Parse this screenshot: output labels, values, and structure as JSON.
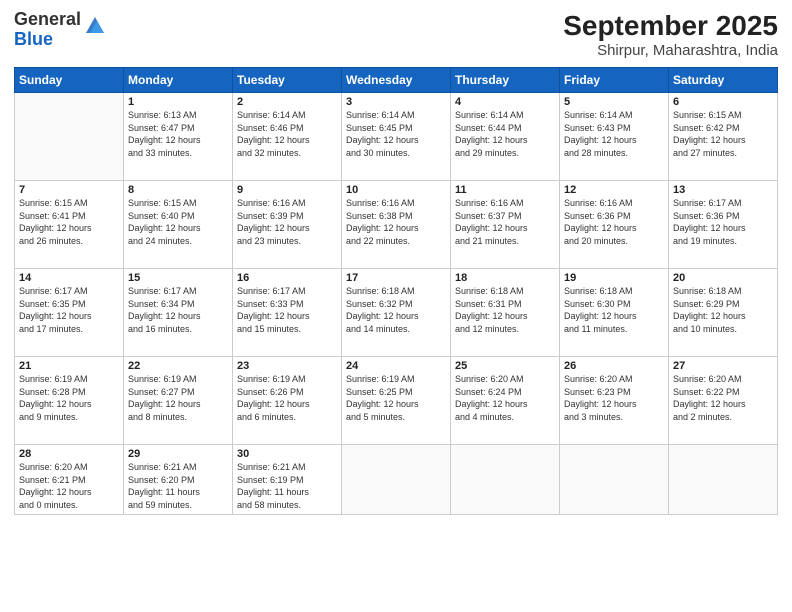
{
  "header": {
    "logo": {
      "line1": "General",
      "line2": "Blue"
    },
    "title": "September 2025",
    "location": "Shirpur, Maharashtra, India"
  },
  "weekdays": [
    "Sunday",
    "Monday",
    "Tuesday",
    "Wednesday",
    "Thursday",
    "Friday",
    "Saturday"
  ],
  "weeks": [
    [
      {
        "day": "",
        "info": ""
      },
      {
        "day": "1",
        "info": "Sunrise: 6:13 AM\nSunset: 6:47 PM\nDaylight: 12 hours\nand 33 minutes."
      },
      {
        "day": "2",
        "info": "Sunrise: 6:14 AM\nSunset: 6:46 PM\nDaylight: 12 hours\nand 32 minutes."
      },
      {
        "day": "3",
        "info": "Sunrise: 6:14 AM\nSunset: 6:45 PM\nDaylight: 12 hours\nand 30 minutes."
      },
      {
        "day": "4",
        "info": "Sunrise: 6:14 AM\nSunset: 6:44 PM\nDaylight: 12 hours\nand 29 minutes."
      },
      {
        "day": "5",
        "info": "Sunrise: 6:14 AM\nSunset: 6:43 PM\nDaylight: 12 hours\nand 28 minutes."
      },
      {
        "day": "6",
        "info": "Sunrise: 6:15 AM\nSunset: 6:42 PM\nDaylight: 12 hours\nand 27 minutes."
      }
    ],
    [
      {
        "day": "7",
        "info": "Sunrise: 6:15 AM\nSunset: 6:41 PM\nDaylight: 12 hours\nand 26 minutes."
      },
      {
        "day": "8",
        "info": "Sunrise: 6:15 AM\nSunset: 6:40 PM\nDaylight: 12 hours\nand 24 minutes."
      },
      {
        "day": "9",
        "info": "Sunrise: 6:16 AM\nSunset: 6:39 PM\nDaylight: 12 hours\nand 23 minutes."
      },
      {
        "day": "10",
        "info": "Sunrise: 6:16 AM\nSunset: 6:38 PM\nDaylight: 12 hours\nand 22 minutes."
      },
      {
        "day": "11",
        "info": "Sunrise: 6:16 AM\nSunset: 6:37 PM\nDaylight: 12 hours\nand 21 minutes."
      },
      {
        "day": "12",
        "info": "Sunrise: 6:16 AM\nSunset: 6:36 PM\nDaylight: 12 hours\nand 20 minutes."
      },
      {
        "day": "13",
        "info": "Sunrise: 6:17 AM\nSunset: 6:36 PM\nDaylight: 12 hours\nand 19 minutes."
      }
    ],
    [
      {
        "day": "14",
        "info": "Sunrise: 6:17 AM\nSunset: 6:35 PM\nDaylight: 12 hours\nand 17 minutes."
      },
      {
        "day": "15",
        "info": "Sunrise: 6:17 AM\nSunset: 6:34 PM\nDaylight: 12 hours\nand 16 minutes."
      },
      {
        "day": "16",
        "info": "Sunrise: 6:17 AM\nSunset: 6:33 PM\nDaylight: 12 hours\nand 15 minutes."
      },
      {
        "day": "17",
        "info": "Sunrise: 6:18 AM\nSunset: 6:32 PM\nDaylight: 12 hours\nand 14 minutes."
      },
      {
        "day": "18",
        "info": "Sunrise: 6:18 AM\nSunset: 6:31 PM\nDaylight: 12 hours\nand 12 minutes."
      },
      {
        "day": "19",
        "info": "Sunrise: 6:18 AM\nSunset: 6:30 PM\nDaylight: 12 hours\nand 11 minutes."
      },
      {
        "day": "20",
        "info": "Sunrise: 6:18 AM\nSunset: 6:29 PM\nDaylight: 12 hours\nand 10 minutes."
      }
    ],
    [
      {
        "day": "21",
        "info": "Sunrise: 6:19 AM\nSunset: 6:28 PM\nDaylight: 12 hours\nand 9 minutes."
      },
      {
        "day": "22",
        "info": "Sunrise: 6:19 AM\nSunset: 6:27 PM\nDaylight: 12 hours\nand 8 minutes."
      },
      {
        "day": "23",
        "info": "Sunrise: 6:19 AM\nSunset: 6:26 PM\nDaylight: 12 hours\nand 6 minutes."
      },
      {
        "day": "24",
        "info": "Sunrise: 6:19 AM\nSunset: 6:25 PM\nDaylight: 12 hours\nand 5 minutes."
      },
      {
        "day": "25",
        "info": "Sunrise: 6:20 AM\nSunset: 6:24 PM\nDaylight: 12 hours\nand 4 minutes."
      },
      {
        "day": "26",
        "info": "Sunrise: 6:20 AM\nSunset: 6:23 PM\nDaylight: 12 hours\nand 3 minutes."
      },
      {
        "day": "27",
        "info": "Sunrise: 6:20 AM\nSunset: 6:22 PM\nDaylight: 12 hours\nand 2 minutes."
      }
    ],
    [
      {
        "day": "28",
        "info": "Sunrise: 6:20 AM\nSunset: 6:21 PM\nDaylight: 12 hours\nand 0 minutes."
      },
      {
        "day": "29",
        "info": "Sunrise: 6:21 AM\nSunset: 6:20 PM\nDaylight: 11 hours\nand 59 minutes."
      },
      {
        "day": "30",
        "info": "Sunrise: 6:21 AM\nSunset: 6:19 PM\nDaylight: 11 hours\nand 58 minutes."
      },
      {
        "day": "",
        "info": ""
      },
      {
        "day": "",
        "info": ""
      },
      {
        "day": "",
        "info": ""
      },
      {
        "day": "",
        "info": ""
      }
    ]
  ]
}
